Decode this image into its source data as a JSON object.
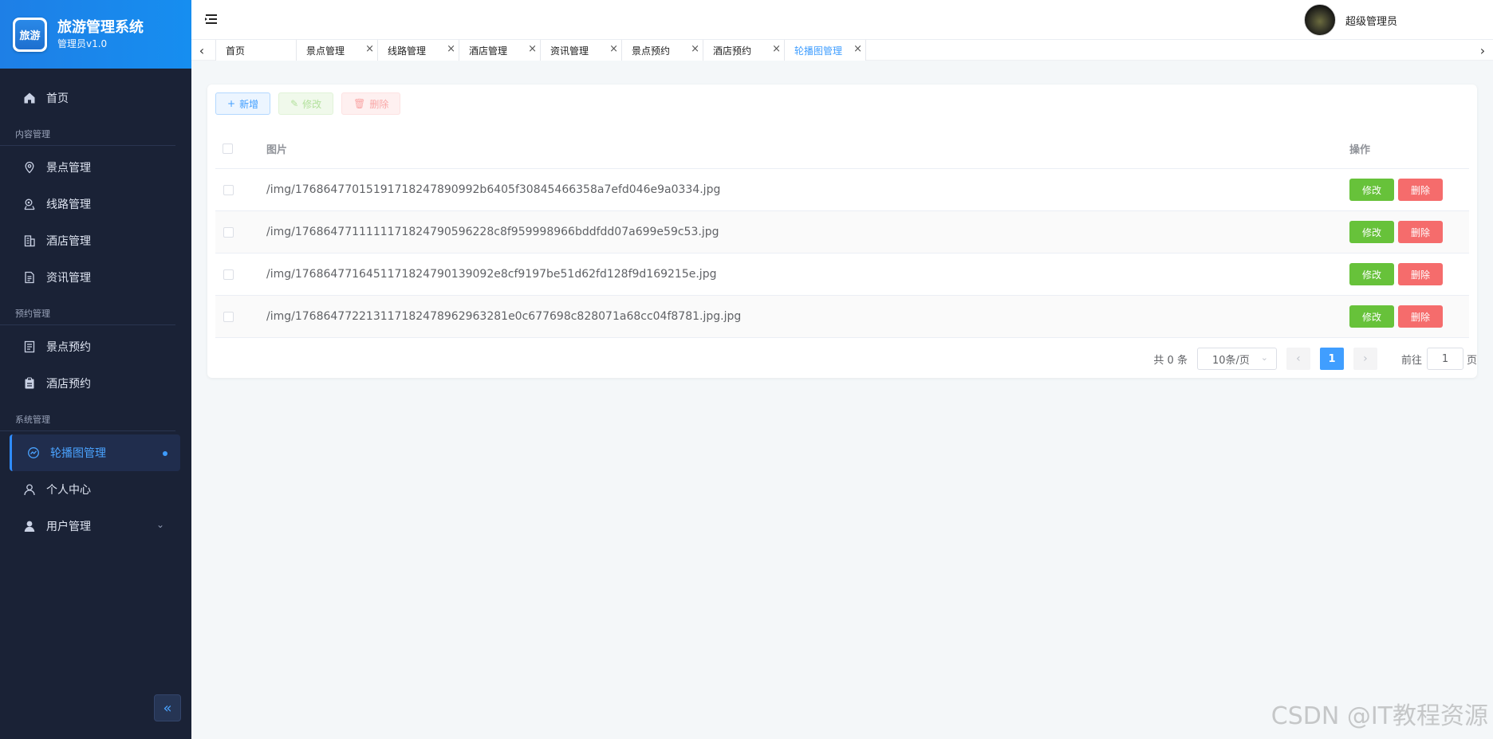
{
  "brand": {
    "logo_text": "旅游",
    "title": "旅游管理系统",
    "subtitle": "管理员v1.0"
  },
  "sidebar": {
    "home": "首页",
    "groups": [
      {
        "label": "内容管理",
        "items": [
          "景点管理",
          "线路管理",
          "酒店管理",
          "资讯管理"
        ]
      },
      {
        "label": "预约管理",
        "items": [
          "景点预约",
          "酒店预约"
        ]
      },
      {
        "label": "系统管理",
        "items": [
          "轮播图管理",
          "个人中心",
          "用户管理"
        ]
      }
    ]
  },
  "header": {
    "user_name": "超级管理员"
  },
  "tabs": [
    "首页",
    "景点管理",
    "线路管理",
    "酒店管理",
    "资讯管理",
    "景点预约",
    "酒店预约",
    "轮播图管理"
  ],
  "active_tab": "轮播图管理",
  "toolbar": {
    "add_label": "新增",
    "edit_label": "修改",
    "delete_label": "删除"
  },
  "table": {
    "columns": {
      "image": "图片",
      "operation": "操作"
    },
    "rows": [
      "/img/17686477015191718247890992b6405f30845466358a7efd046e9a0334.jpg",
      "/img/17686477111111718247905962​28c8f959998966bddfdd07a699e59c53.jpg",
      "/img/176864771645117182479013909​2e8cf9197be51d62fd128f9d169215e.jpg",
      "/img/17686477221311718247896296​3281e0c677698c828071a68cc04f8781.jpg.jpg"
    ],
    "row_edit": "修改",
    "row_delete": "删除"
  },
  "pager": {
    "total": "共 0 条",
    "page_size": "10条/页",
    "current": "1",
    "goto_prefix": "前往",
    "goto_value": "1",
    "goto_suffix": "页"
  },
  "watermark": "CSDN @IT教程资源",
  "colors": {
    "sidebar_bg": "#1a2236",
    "brand_bg": "#1e7fe6",
    "primary": "#409eff",
    "success": "#67c23a",
    "danger": "#f56c6c"
  }
}
